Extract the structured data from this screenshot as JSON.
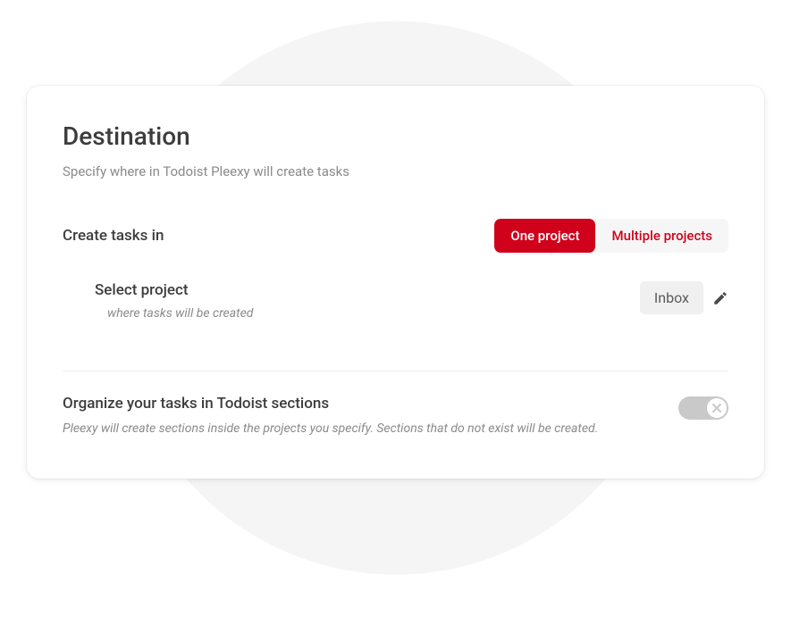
{
  "header": {
    "title": "Destination",
    "subtitle": "Specify where in Todoist Pleexy will create tasks"
  },
  "createTasks": {
    "label": "Create tasks in",
    "options": {
      "oneProject": "One project",
      "multipleProjects": "Multiple projects"
    }
  },
  "selectProject": {
    "label": "Select project",
    "description": "where tasks will be created",
    "value": "Inbox"
  },
  "organize": {
    "title": "Organize your tasks in Todoist sections",
    "description": "Pleexy will create sections inside the projects you specify. Sections that do not exist will be created."
  }
}
